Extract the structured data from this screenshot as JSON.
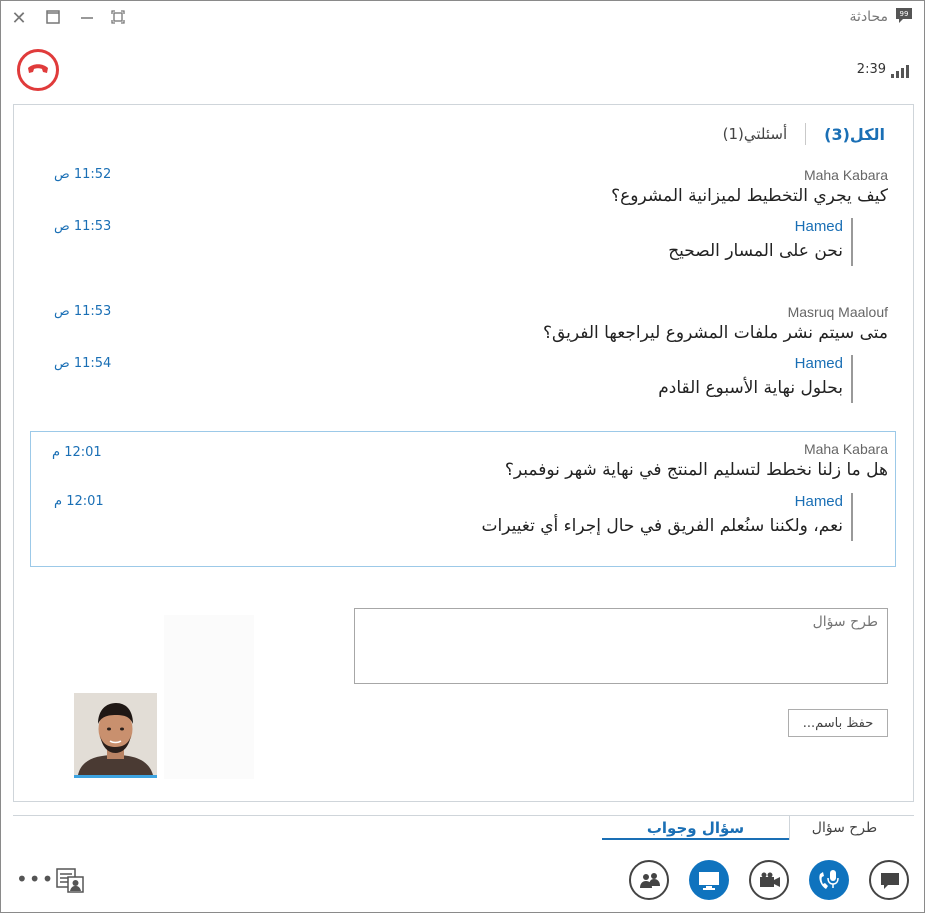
{
  "window": {
    "title": "محادثة"
  },
  "call": {
    "duration": "2:39"
  },
  "filters": {
    "all": "الكل(3)",
    "mine": "أسئلتي(1)"
  },
  "threads": [
    {
      "sender": "Maha Kabara",
      "question": "كيف يجري التخطيط لميزانية المشروع؟",
      "question_time": "11:52 ص",
      "answer_name": "Hamed",
      "answer": "نحن على المسار الصحيح",
      "answer_time": "11:53 ص"
    },
    {
      "sender": "Masruq Maalouf",
      "question": "متى سيتم نشر ملفات المشروع ليراجعها الفريق؟",
      "question_time": "11:53 ص",
      "answer_name": "Hamed",
      "answer": "بحلول نهاية الأسبوع القادم",
      "answer_time": "11:54 ص"
    },
    {
      "sender": "Maha Kabara",
      "question": "هل ما زلنا نخطط لتسليم المنتج في نهاية شهر نوفمبر؟",
      "question_time": "12:01 م",
      "answer_name": "Hamed",
      "answer": "نعم، ولكننا سنُعلم الفريق في حال إجراء أي تغييرات",
      "answer_time": "12:01 م"
    }
  ],
  "ask": {
    "placeholder": "طرح سؤال",
    "save_label": "حفظ باسم..."
  },
  "tabs": {
    "qa": "سؤال وجواب",
    "ask": "طرح سؤال"
  },
  "toolbar": {
    "more": "•••"
  },
  "colors": {
    "accent": "#1a6fb5",
    "hangup": "#e03b3b",
    "button_blue": "#0f73be"
  },
  "icons": [
    "close-icon",
    "maximize-icon",
    "minimize-icon",
    "fullscreen-icon",
    "conversation-icon",
    "hangup-icon",
    "signal-icon",
    "people-icon",
    "present-screen-icon",
    "video-camera-icon",
    "microphone-phone-icon",
    "chat-icon",
    "contact-card-icon",
    "more-options-icon"
  ]
}
